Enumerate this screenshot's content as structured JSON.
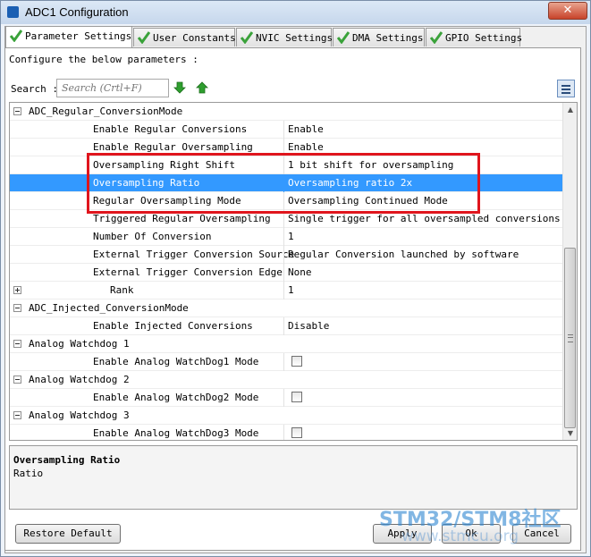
{
  "window": {
    "title": "ADC1 Configuration",
    "close_glyph": "✕"
  },
  "tabs": [
    {
      "label": "Parameter Settings",
      "active": true
    },
    {
      "label": "User Constants",
      "active": false
    },
    {
      "label": "NVIC Settings",
      "active": false
    },
    {
      "label": "DMA Settings",
      "active": false
    },
    {
      "label": "GPIO Settings",
      "active": false
    }
  ],
  "intro": "Configure the below parameters :",
  "search": {
    "label": "Search :",
    "placeholder": "Search (Crtl+F)"
  },
  "grid": {
    "rows": [
      {
        "type": "group",
        "key": "ADC_Regular_ConversionMode",
        "toggle": "minus"
      },
      {
        "type": "param",
        "key": "Enable Regular Conversions",
        "value": "Enable"
      },
      {
        "type": "param",
        "key": "Enable Regular Oversampling",
        "value": "Enable"
      },
      {
        "type": "param",
        "key": "Oversampling Right Shift",
        "value": "1 bit shift for oversampling"
      },
      {
        "type": "param",
        "key": "Oversampling Ratio",
        "value": "Oversampling ratio 2x",
        "selected": true
      },
      {
        "type": "param",
        "key": "Regular Oversampling Mode",
        "value": "Oversampling Continued Mode"
      },
      {
        "type": "param",
        "key": "Triggered Regular Oversampling",
        "value": "Single trigger for all oversampled conversions"
      },
      {
        "type": "param",
        "key": "Number Of Conversion",
        "value": "1"
      },
      {
        "type": "param",
        "key": "External Trigger Conversion Source",
        "value": "Regular Conversion launched by software"
      },
      {
        "type": "param",
        "key": "External Trigger Conversion Edge",
        "value": "None"
      },
      {
        "type": "sub",
        "key": "Rank",
        "value": "1",
        "toggle": "plus"
      },
      {
        "type": "group",
        "key": "ADC_Injected_ConversionMode",
        "toggle": "minus"
      },
      {
        "type": "param",
        "key": "Enable Injected Conversions",
        "value": "Disable"
      },
      {
        "type": "group",
        "key": "Analog Watchdog 1",
        "toggle": "minus"
      },
      {
        "type": "param",
        "key": "Enable Analog WatchDog1 Mode",
        "checkbox": true
      },
      {
        "type": "group",
        "key": "Analog Watchdog 2",
        "toggle": "minus"
      },
      {
        "type": "param",
        "key": "Enable Analog WatchDog2 Mode",
        "checkbox": true
      },
      {
        "type": "group",
        "key": "Analog Watchdog 3",
        "toggle": "minus"
      },
      {
        "type": "param",
        "key": "Enable Analog WatchDog3 Mode",
        "checkbox": true
      }
    ]
  },
  "description": {
    "title": "Oversampling Ratio",
    "text": "Ratio"
  },
  "buttons": {
    "restore_default": "Restore Default",
    "apply": "Apply",
    "ok": "Ok",
    "cancel": "Cancel"
  },
  "watermark": {
    "brand": "STM32/STM8社区",
    "url": "www.stmcu.org"
  },
  "colors": {
    "selection": "#3399ff",
    "highlight_box": "#e0151d",
    "tab_check": "#3aa23a",
    "arrow_green": "#2e9e2e"
  }
}
